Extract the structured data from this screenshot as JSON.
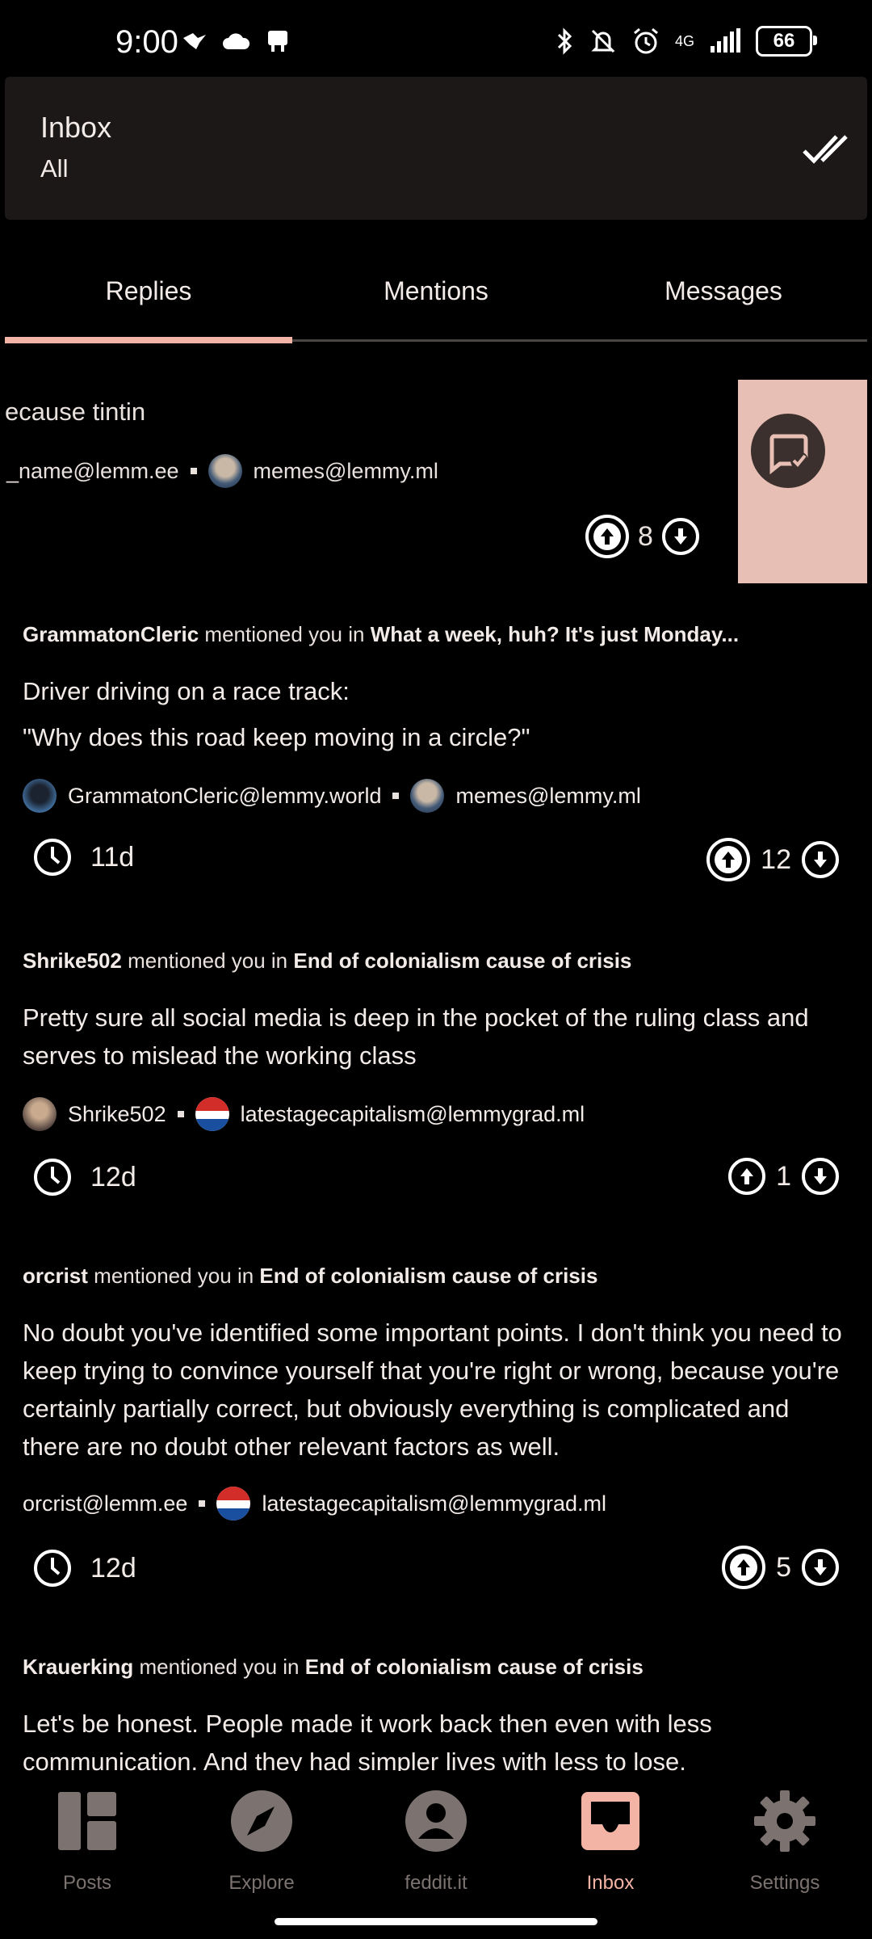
{
  "status_bar": {
    "time": "9:00",
    "network": "4G",
    "battery": "66"
  },
  "header": {
    "title": "Inbox",
    "subtitle": "All"
  },
  "tabs": [
    {
      "label": "Replies"
    },
    {
      "label": "Mentions"
    },
    {
      "label": "Messages"
    }
  ],
  "swiped_reply": {
    "text": "ecause tintin",
    "author": "_name@lemm.ee",
    "community": "memes@lemmy.ml",
    "score": "8"
  },
  "mentions": [
    {
      "user": "GrammatonCleric",
      "verb": "mentioned you in",
      "post": "What a week, huh? It's just Monday...",
      "body_lines": [
        "Driver driving on a race track:",
        "\"Why does this road keep moving in a circle?\""
      ],
      "author": "GrammatonCleric@lemmy.world",
      "community": "memes@lemmy.ml",
      "age": "11d",
      "score": "12"
    },
    {
      "user": "Shrike502",
      "verb": "mentioned you in",
      "post": "End of colonialism cause of crisis",
      "body": "Pretty sure all social media is deep in the pocket of the ruling class and serves to mislead the working class",
      "author": "Shrike502",
      "community": "latestagecapitalism@lemmygrad.ml",
      "age": "12d",
      "score": "1"
    },
    {
      "user": "orcrist",
      "verb": "mentioned you in",
      "post": "End of colonialism cause of crisis",
      "body": "No doubt you've identified some important points. I don't think you need to keep trying to convince yourself that you're right or wrong, because you're certainly partially correct, but obviously everything is complicated and there are no doubt other relevant factors as well.",
      "author": "orcrist@lemm.ee",
      "community": "latestagecapitalism@lemmygrad.ml",
      "age": "12d",
      "score": "5"
    },
    {
      "user": "Krauerking",
      "verb": "mentioned you in",
      "post": "End of colonialism cause of crisis",
      "body": "Let's be honest. People made it work back then even with less communication. And they had simpler lives with less to lose."
    }
  ],
  "bottom_nav": [
    {
      "label": "Posts",
      "icon": "posts-icon"
    },
    {
      "label": "Explore",
      "icon": "compass-icon"
    },
    {
      "label": "feddit.it",
      "icon": "account-icon"
    },
    {
      "label": "Inbox",
      "icon": "inbox-icon",
      "active": true
    },
    {
      "label": "Settings",
      "icon": "gear-icon"
    }
  ],
  "colors": {
    "accent": "#f4b4a5",
    "header_bg": "#1c1817",
    "swipe_action": "#e8bfb4"
  }
}
